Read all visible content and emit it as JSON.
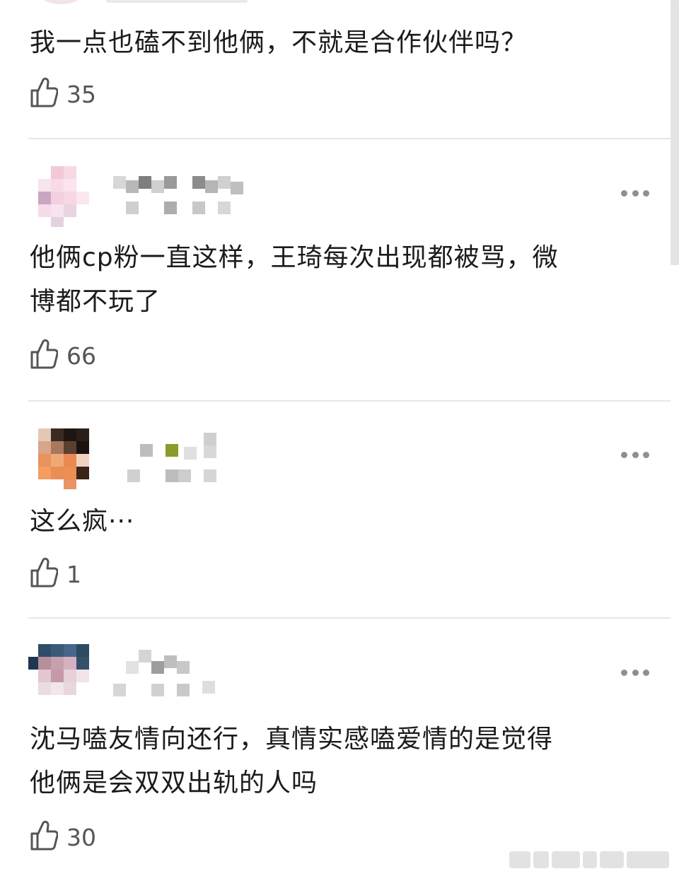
{
  "comments": [
    {
      "text": "我一点也磕不到他俩，不就是合作伙伴吗？",
      "likes": "35",
      "like_icon": "thumbs-up-icon"
    },
    {
      "text": "他俩cp粉一直这样，王琦每次出现都被骂，微\n博都不玩了",
      "likes": "66",
      "like_icon": "thumbs-up-icon",
      "more_icon": "more-icon"
    },
    {
      "text": "这么疯···",
      "likes": "1",
      "like_icon": "thumbs-up-icon",
      "more_icon": "more-icon"
    },
    {
      "text": "沈马嗑友情向还行，真情实感嗑爱情的是觉得\n他俩是会双双出轨的人吗",
      "likes": "30",
      "like_icon": "thumbs-up-icon",
      "more_icon": "more-icon"
    }
  ],
  "colors": {
    "text": "#1b1b1b",
    "meta": "#555555",
    "divider": "#e6e6e6",
    "dots": "#8f8f8f"
  }
}
